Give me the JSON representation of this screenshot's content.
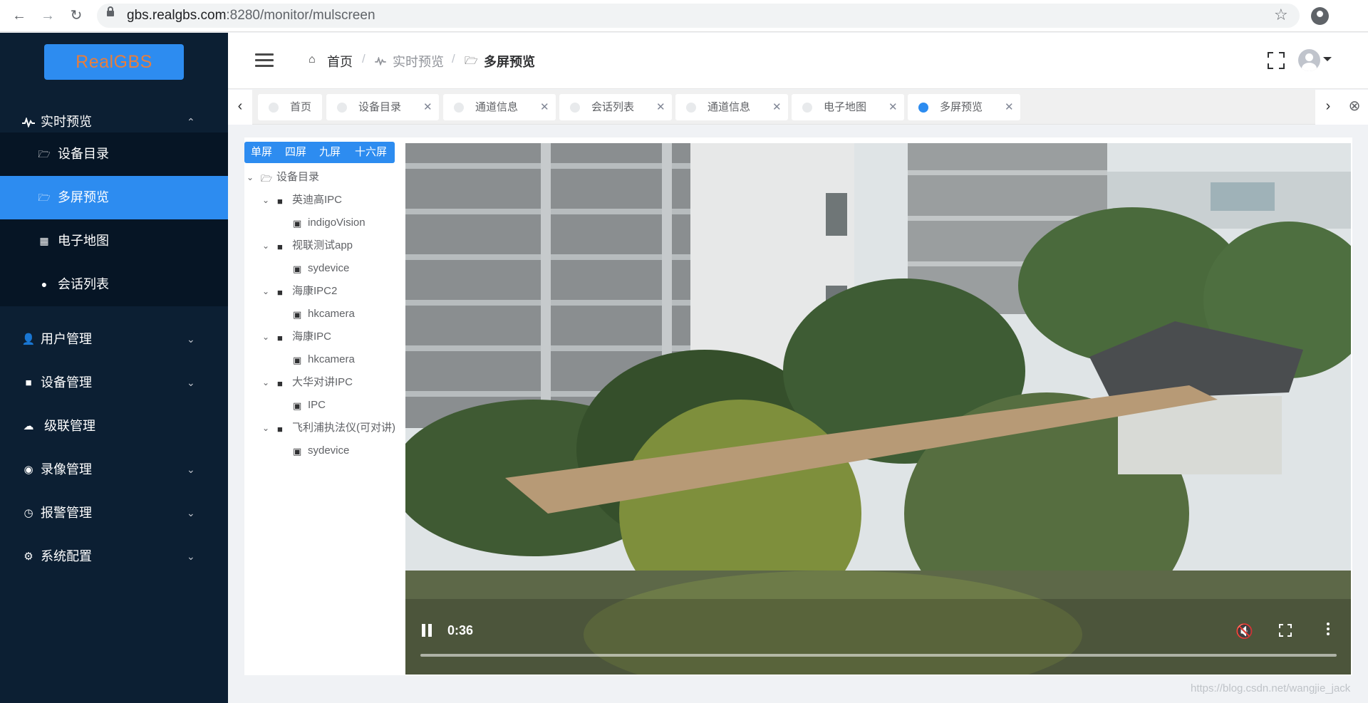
{
  "browser": {
    "url_host": "gbs.realgbs.com",
    "url_path": ":8280/monitor/mulscreen"
  },
  "sidebar": {
    "logo": "RealGBS",
    "menu": [
      {
        "label": "实时预览",
        "icon": "pulse-icon",
        "expanded": true
      },
      {
        "label": "用户管理",
        "icon": "user-icon"
      },
      {
        "label": "设备管理",
        "icon": "camera-icon"
      },
      {
        "label": "级联管理",
        "icon": "cloud-icon"
      },
      {
        "label": "录像管理",
        "icon": "record-icon"
      },
      {
        "label": "报警管理",
        "icon": "alarm-clock-icon"
      },
      {
        "label": "系统配置",
        "icon": "gear-icon"
      }
    ],
    "submenu": [
      {
        "label": "设备目录",
        "icon": "folder-icon"
      },
      {
        "label": "多屏预览",
        "icon": "folder-icon",
        "active": true
      },
      {
        "label": "电子地图",
        "icon": "map-icon"
      },
      {
        "label": "会话列表",
        "icon": "chat-icon"
      }
    ]
  },
  "header": {
    "breadcrumb": [
      "首页",
      "实时预览",
      "多屏预览"
    ]
  },
  "tabs": [
    {
      "label": "首页",
      "closable": false,
      "active": false
    },
    {
      "label": "设备目录",
      "closable": true,
      "active": false
    },
    {
      "label": "通道信息",
      "closable": true,
      "active": false
    },
    {
      "label": "会话列表",
      "closable": true,
      "active": false
    },
    {
      "label": "通道信息",
      "closable": true,
      "active": false
    },
    {
      "label": "电子地图",
      "closable": true,
      "active": false
    },
    {
      "label": "多屏预览",
      "closable": true,
      "active": true
    }
  ],
  "screen_buttons": [
    "单屏",
    "四屏",
    "九屏",
    "十六屏"
  ],
  "tree": {
    "root": "设备目录",
    "devices": [
      {
        "name": "英迪高IPC",
        "channel": "indigoVision"
      },
      {
        "name": "视联测试app",
        "channel": "sydevice"
      },
      {
        "name": "海康IPC2",
        "channel": "hkcamera"
      },
      {
        "name": "海康IPC",
        "channel": "hkcamera"
      },
      {
        "name": "大华对讲IPC",
        "channel": "IPC"
      },
      {
        "name": "飞利浦执法仪(可对讲)",
        "channel": "sydevice"
      }
    ]
  },
  "video": {
    "time": "0:36",
    "state": "playing",
    "muted": true
  },
  "watermark": "https://blog.csdn.net/wangjie_jack",
  "colors": {
    "sidebar_bg": "#0c1f33",
    "accent": "#2d8cf0",
    "logo_text": "#e87e3c"
  }
}
